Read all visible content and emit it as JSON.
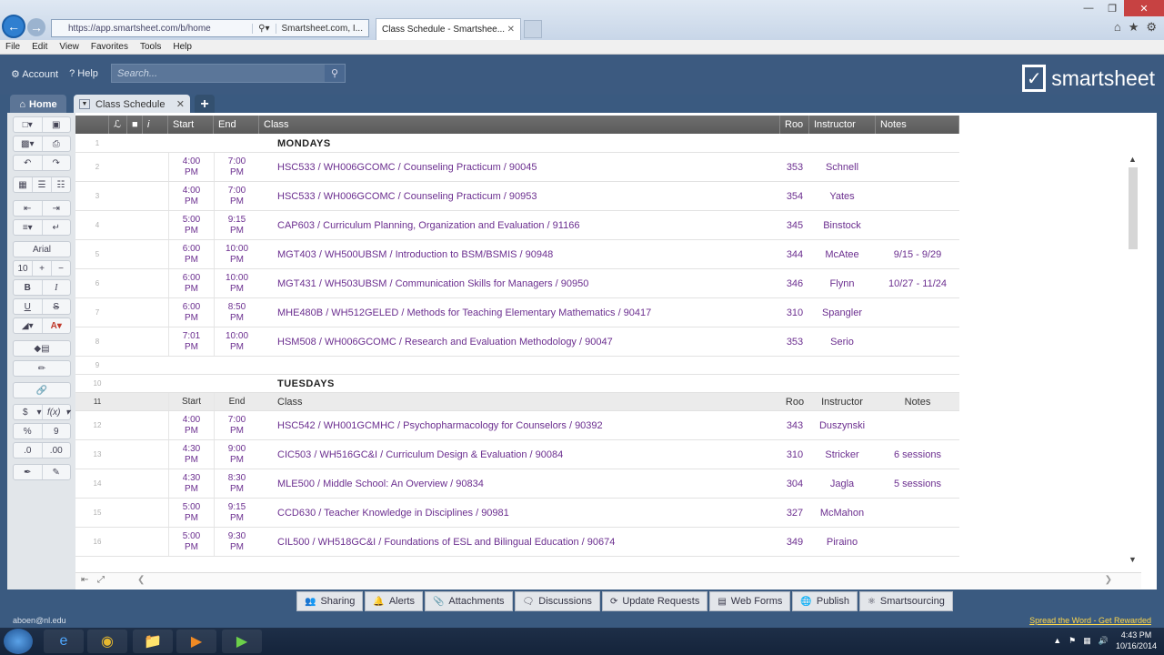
{
  "browser": {
    "url": "https://app.smartsheet.com/b/home",
    "site_segment": "Smartsheet.com, I...",
    "tab_title": "Class Schedule - Smartshee...",
    "menu": [
      "File",
      "Edit",
      "View",
      "Favorites",
      "Tools",
      "Help"
    ]
  },
  "app": {
    "account_label": "Account",
    "help_label": "Help",
    "search_placeholder": "Search...",
    "logo_text": "smartsheet",
    "home_tab": "Home",
    "sheet_tab": "Class Schedule",
    "add_tab": "+"
  },
  "toolbar": {
    "font": "Arial",
    "size": "10",
    "bold": "B",
    "italic": "I",
    "underline": "U",
    "strike": "S",
    "currency": "$",
    "percent": "%",
    "fx": "f(x)",
    "comma": "9"
  },
  "columns": {
    "start": "Start",
    "end": "End",
    "class": "Class",
    "room": "Roo",
    "instructor": "Instructor",
    "notes": "Notes"
  },
  "rows": [
    {
      "n": "1",
      "type": "section",
      "class": "MONDAYS"
    },
    {
      "n": "2",
      "start": "4:00\nPM",
      "end": "7:00\nPM",
      "class": "HSC533 / WH006GCOMC / Counseling Practicum / 90045",
      "room": "353",
      "instructor": "Schnell",
      "notes": ""
    },
    {
      "n": "3",
      "start": "4:00\nPM",
      "end": "7:00\nPM",
      "class": "HSC533 / WH006GCOMC / Counseling Practicum / 90953",
      "room": "354",
      "instructor": "Yates",
      "notes": ""
    },
    {
      "n": "4",
      "start": "5:00\nPM",
      "end": "9:15\nPM",
      "class": "CAP603 / Curriculum Planning, Organization and Evaluation / 91166",
      "room": "345",
      "instructor": "Binstock",
      "notes": ""
    },
    {
      "n": "5",
      "start": "6:00\nPM",
      "end": "10:00\nPM",
      "class": "MGT403 / WH500UBSM / Introduction to BSM/BSMIS / 90948",
      "room": "344",
      "instructor": "McAtee",
      "notes": "9/15 - 9/29"
    },
    {
      "n": "6",
      "start": "6:00\nPM",
      "end": "10:00\nPM",
      "class": "MGT431 / WH503UBSM / Communication Skills for Managers / 90950",
      "room": "346",
      "instructor": "Flynn",
      "notes": "10/27 - 11/24"
    },
    {
      "n": "7",
      "start": "6:00\nPM",
      "end": "8:50\nPM",
      "class": "MHE480B / WH512GELED / Methods for Teaching Elementary Mathematics / 90417",
      "room": "310",
      "instructor": "Spangler",
      "notes": ""
    },
    {
      "n": "8",
      "start": "7:01\nPM",
      "end": "10:00\nPM",
      "class": "HSM508 / WH006GCOMC / Research and Evaluation Methodology / 90047",
      "room": "353",
      "instructor": "Serio",
      "notes": ""
    },
    {
      "n": "9",
      "type": "blank"
    },
    {
      "n": "10",
      "type": "section",
      "class": "TUESDAYS"
    },
    {
      "n": "11",
      "type": "subhead",
      "start": "Start",
      "end": "End",
      "class": "Class",
      "room": "Roo",
      "instructor": "Instructor",
      "notes": "Notes"
    },
    {
      "n": "12",
      "start": "4:00\nPM",
      "end": "7:00\nPM",
      "class": "HSC542 / WH001GCMHC / Psychopharmacology for Counselors / 90392",
      "room": "343",
      "instructor": "Duszynski",
      "notes": ""
    },
    {
      "n": "13",
      "start": "4:30\nPM",
      "end": "9:00\nPM",
      "class": "CIC503 / WH516GC&I / Curriculum Design & Evaluation / 90084",
      "room": "310",
      "instructor": "Stricker",
      "notes": "6 sessions"
    },
    {
      "n": "14",
      "start": "4:30\nPM",
      "end": "8:30\nPM",
      "class": "MLE500 / Middle School: An Overview / 90834",
      "room": "304",
      "instructor": "Jagla",
      "notes": "5 sessions"
    },
    {
      "n": "15",
      "start": "5:00\nPM",
      "end": "9:15\nPM",
      "class": "CCD630 / Teacher Knowledge in Disciplines / 90981",
      "room": "327",
      "instructor": "McMahon",
      "notes": ""
    },
    {
      "n": "16",
      "start": "5:00\nPM",
      "end": "9:30\nPM",
      "class": "CIL500 / WH518GC&I / Foundations of ESL and Bilingual Education / 90674",
      "room": "349",
      "instructor": "Piraino",
      "notes": ""
    }
  ],
  "bottom_tabs": [
    "Sharing",
    "Alerts",
    "Attachments",
    "Discussions",
    "Update Requests",
    "Web Forms",
    "Publish",
    "Smartsourcing"
  ],
  "status": {
    "user": "aboen@nl.edu",
    "promo": "Spread the Word - Get Rewarded"
  },
  "taskbar": {
    "time": "4:43 PM",
    "date": "10/16/2014"
  },
  "colors": {
    "accent": "#3c5a80",
    "link_text": "#6b2e8f"
  }
}
